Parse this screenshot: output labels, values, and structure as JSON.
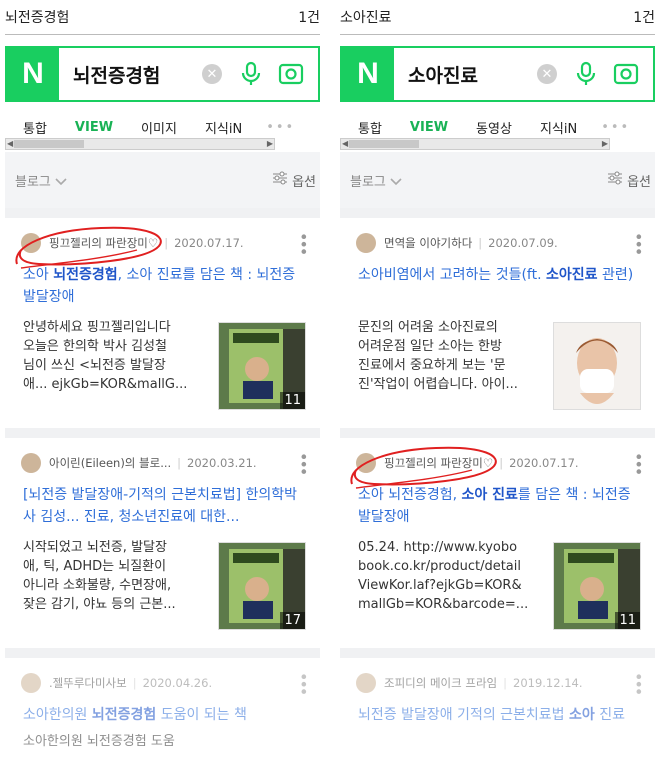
{
  "panels": [
    {
      "header": {
        "query_label": "뇌전증경험",
        "count": "1건"
      },
      "search": {
        "logo": "N",
        "query": "뇌전증경험"
      },
      "tabs": [
        "통합",
        "VIEW",
        "이미지",
        "지식iN",
        "•••"
      ],
      "filter": {
        "left": "블로그",
        "right": "옵션"
      },
      "posts": [
        {
          "author": "핑끄젤리의 파란장미♡",
          "date": "2020.07.17.",
          "title_pre": "소아 ",
          "title_hl": "뇌전증경험",
          "title_post": ", 소아 진료를 담은 책 : 뇌전증발달장애",
          "desc": [
            "안녕하세요 핑끄젤리입니다",
            "오늘은 한의학 박사 김성철",
            "님이 쓰신 <뇌전증 발달장",
            "애... ejkGb=KOR&mallG..."
          ],
          "count": "11"
        },
        {
          "author": "아이린(Eileen)의 블로...",
          "date": "2020.03.21.",
          "title_pre": "[뇌전증 발달장애-기적의 근본치료법] 한의학박사 김성... 진료, 청소년진료에 대한...",
          "title_hl": "",
          "title_post": "",
          "desc": [
            "시작되었고 뇌전증, 발달장",
            "애, 틱, ADHD는 뇌질환이",
            "아니라 소화불량, 수면장애,",
            "잦은 감기, 야뇨 등의 근본..."
          ],
          "count": "17"
        },
        {
          "author": ".젤뚜루다미사보",
          "date": "2020.04.26.",
          "title_pre": "소아한의원 ",
          "title_hl": "뇌전증경험",
          "title_post": " 도움이 되는 책",
          "desc": [
            "소아한의원 뇌전증경험 도움"
          ],
          "count": ""
        }
      ]
    },
    {
      "header": {
        "query_label": "소아진료",
        "count": "1건"
      },
      "search": {
        "logo": "N",
        "query": "소아진료"
      },
      "tabs": [
        "통합",
        "VIEW",
        "동영상",
        "지식iN",
        "•••"
      ],
      "filter": {
        "left": "블로그",
        "right": "옵션"
      },
      "posts": [
        {
          "author": "면역을 이야기하다",
          "date": "2020.07.09.",
          "title_pre": "소아비염에서 고려하는 것들(ft. ",
          "title_hl": "소아진료",
          "title_post": " 관련)",
          "desc": [
            "문진의 어려움 소아진료의",
            "어려운점 일단 소아는 한방",
            "진료에서 중요하게 보는 '문",
            "진'작업이 어렵습니다. 아이..."
          ],
          "count": ""
        },
        {
          "author": "핑끄젤리의 파란장미♡",
          "date": "2020.07.17.",
          "title_pre": "소아 뇌전증경험, ",
          "title_hl": "소아 진료",
          "title_post": "를 담은 책 : 뇌전증발달장애",
          "desc": [
            "05.24. http://www.kyobo",
            "book.co.kr/product/detail",
            "ViewKor.laf?ejkGb=KOR&",
            "mallGb=KOR&barcode=..."
          ],
          "count": "11"
        },
        {
          "author": "조피디의 메이크 프라임",
          "date": "2019.12.14.",
          "title_pre": "뇌전증 발달장애 기적의 근본치료법 ",
          "title_hl": "소아",
          "title_post": " 진료",
          "desc": [],
          "count": ""
        }
      ]
    }
  ],
  "colors": {
    "brand": "#19ce60",
    "link": "#2f6ed8",
    "annotation": "#e02020"
  },
  "icons": [
    "naver-logo",
    "clear-icon",
    "mic-icon",
    "lens-icon",
    "chevron-down-icon",
    "filter-icon",
    "more-icon"
  ]
}
